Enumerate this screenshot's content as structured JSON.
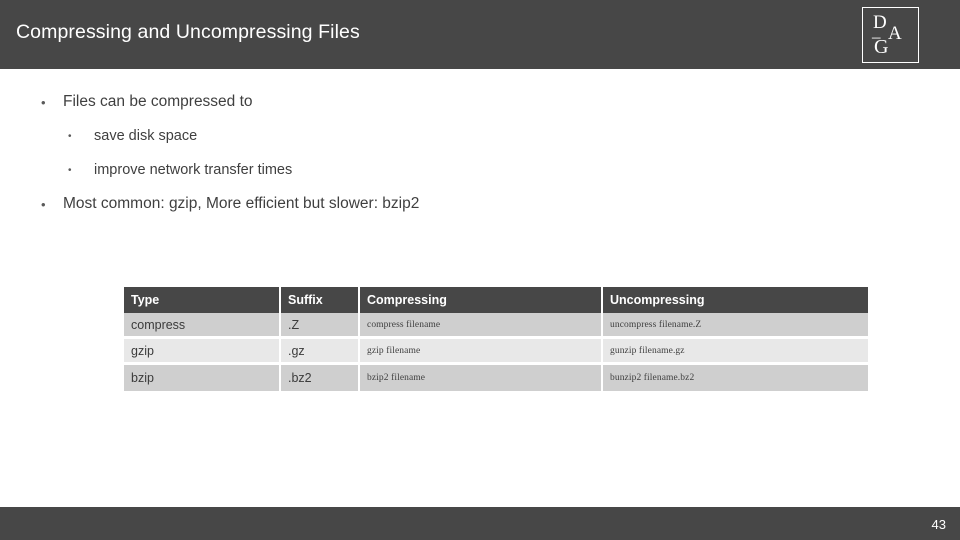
{
  "header": {
    "title": "Compressing and Uncompressing Files",
    "band_color": "#474747",
    "title_color": "#ffffff"
  },
  "logo": {
    "letter_d": "D",
    "letter_dash": "–",
    "letter_a": "A",
    "letter_g": "G"
  },
  "content": {
    "bullets": [
      {
        "level": 1,
        "marker": "•",
        "text": "Files can be compressed to"
      },
      {
        "level": 2,
        "marker": "•",
        "text": "save disk space"
      },
      {
        "level": 2,
        "marker": "•",
        "text": "improve network transfer times"
      },
      {
        "level": 1,
        "marker": "•",
        "text": "Most common: gzip, More efficient but slower: bzip2"
      }
    ]
  },
  "table": {
    "headers": [
      "Type",
      "Suffix",
      "Compressing",
      "Uncompressing"
    ],
    "rows": [
      {
        "type": "compress",
        "suffix": ".Z",
        "compressing": "compress filename",
        "uncompressing": "uncompress filename.Z"
      },
      {
        "type": "gzip",
        "suffix": ".gz",
        "compressing": "gzip filename",
        "uncompressing": "gunzip filename.gz"
      },
      {
        "type": "bzip",
        "suffix": ".bz2",
        "compressing": "bzip2 filename",
        "uncompressing": "bunzip2 filename.bz2"
      }
    ],
    "header_bg": "#474747",
    "row_bg_odd": "#cfcfcf",
    "row_bg_even": "#e8e8e8"
  },
  "footer": {
    "page_number": "43",
    "band_color": "#474747"
  }
}
